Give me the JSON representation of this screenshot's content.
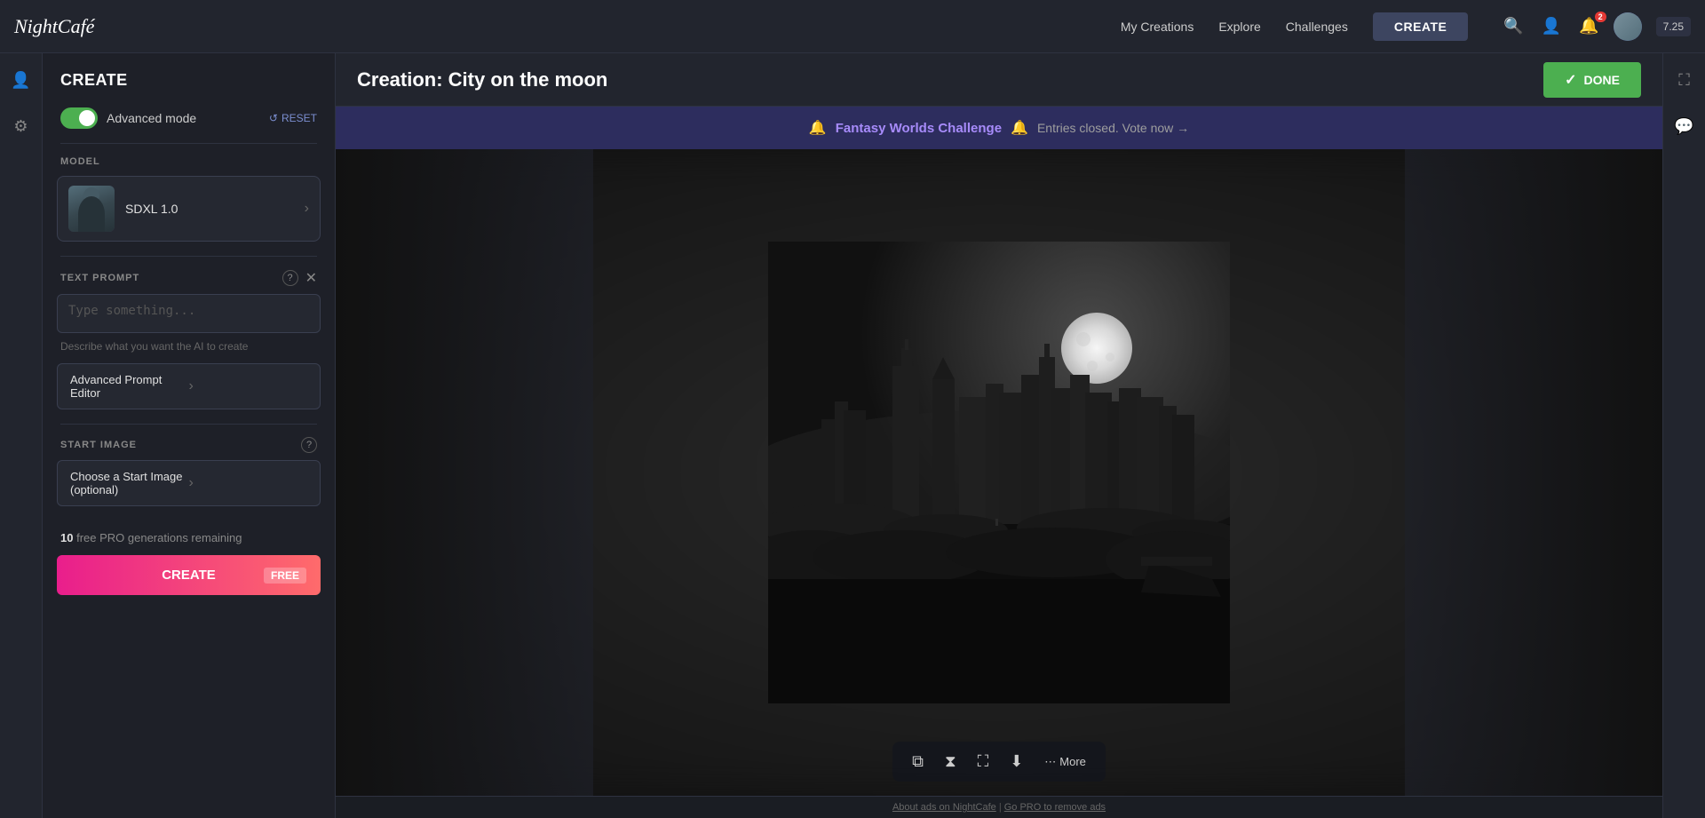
{
  "app": {
    "logo": "NightCafé"
  },
  "topnav": {
    "my_creations": "My Creations",
    "explore": "Explore",
    "challenges": "Challenges",
    "create_btn": "CREATE",
    "credits": "7.25",
    "notification_count": "2"
  },
  "left_panel": {
    "header": "CREATE",
    "advanced_mode_label": "Advanced mode",
    "reset_label": "RESET",
    "model_section": "MODEL",
    "model_name": "SDXL 1.0",
    "text_prompt_section": "TEXT PROMPT",
    "prompt_placeholder": "Type something...",
    "prompt_hint": "Describe what you want the AI to create",
    "advanced_prompt_editor": "Advanced Prompt Editor",
    "start_image_section": "START IMAGE",
    "start_image_btn": "Choose a Start Image (optional)",
    "free_remaining_prefix": "",
    "free_remaining_count": "10",
    "free_remaining_suffix": " free PRO generations remaining",
    "create_btn": "CREATE",
    "free_tag": "FREE"
  },
  "creation": {
    "title": "Creation: City on the moon",
    "done_btn": "DONE"
  },
  "challenge_banner": {
    "icon": "🔔",
    "text": "Fantasy Worlds Challenge",
    "link_text": "Entries closed. Vote now →"
  },
  "image_toolbar": {
    "copy_icon": "⧉",
    "timer_icon": "⧗",
    "expand_icon": "⛶",
    "download_icon": "⬇",
    "more_label": "More"
  },
  "ad_bar": {
    "text1": "About ads on NightCafe",
    "separator": " | ",
    "text2": "Go PRO to remove ads"
  },
  "right_sidebar": {
    "expand_icon": "⛶",
    "chat_icon": "💬"
  }
}
